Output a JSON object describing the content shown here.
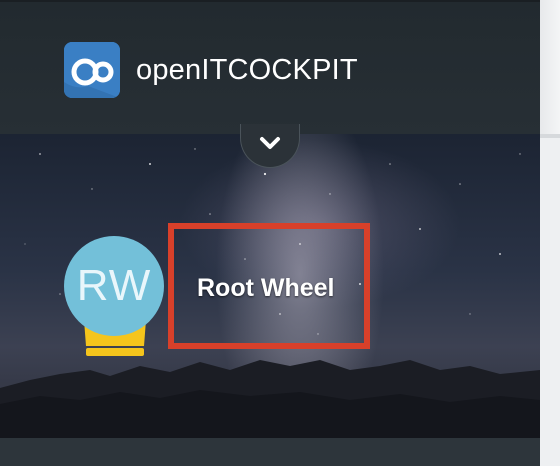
{
  "app": {
    "brand_name": "openITCOCKPIT",
    "logo_icon": "openitcockpit-logo-icon"
  },
  "profile": {
    "avatar_initials": "RW",
    "user_name": "Root Wheel",
    "crown_icon": "crown-icon",
    "toggle_icon": "chevron-down-icon"
  },
  "colors": {
    "brand_blue": "#3a7fc4",
    "avatar_bg": "#73c0d9",
    "crown": "#f5c51c",
    "highlight_box": "#d8402a",
    "sidebar_bg": "#2f363c"
  }
}
